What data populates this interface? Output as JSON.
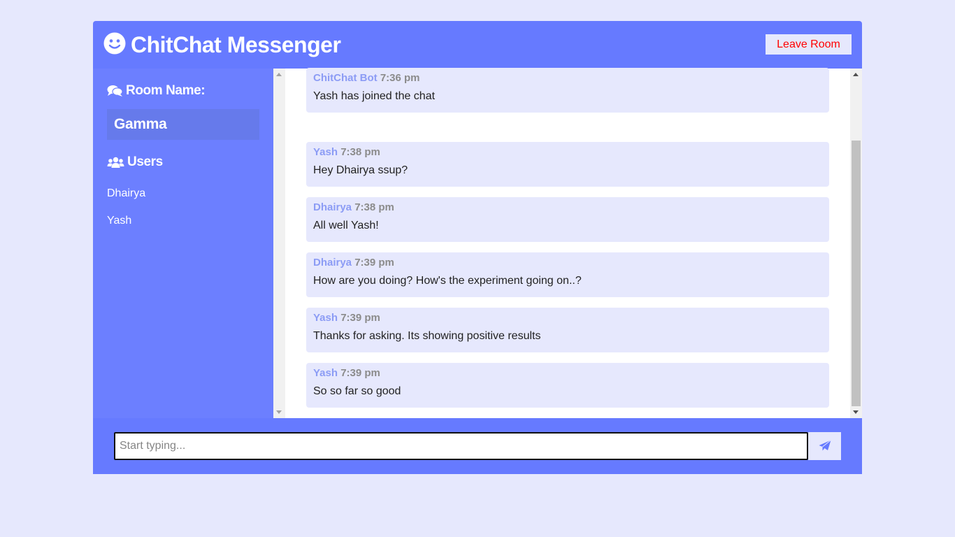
{
  "header": {
    "title": "ChitChat Messenger",
    "logo_icon": "smile-icon",
    "leave_label": "Leave Room"
  },
  "sidebar": {
    "room_heading": "Room Name:",
    "room_name": "Gamma",
    "users_heading": "Users",
    "users": [
      "Dhairya",
      "Yash"
    ]
  },
  "messages": [
    {
      "author": "ChitChat Bot",
      "time": "7:36 pm",
      "text": "Yash has joined the chat"
    },
    {
      "author": "Yash",
      "time": "7:38 pm",
      "text": "Hey Dhairya ssup?"
    },
    {
      "author": "Dhairya",
      "time": "7:38 pm",
      "text": "All well Yash!"
    },
    {
      "author": "Dhairya",
      "time": "7:39 pm",
      "text": "How are you doing? How's the experiment going on..?"
    },
    {
      "author": "Yash",
      "time": "7:39 pm",
      "text": "Thanks for asking. Its showing positive results"
    },
    {
      "author": "Yash",
      "time": "7:39 pm",
      "text": "So so far so good"
    }
  ],
  "composer": {
    "placeholder": "Start typing...",
    "value": "",
    "send_icon": "paper-plane-icon"
  },
  "colors": {
    "page_bg": "#e6e8fd",
    "header_bg": "#667aff",
    "sidebar_bg": "#6c7fff",
    "message_bg": "#e6e8fd",
    "author": "#8c9cf5",
    "leave_text": "#ff0000"
  }
}
